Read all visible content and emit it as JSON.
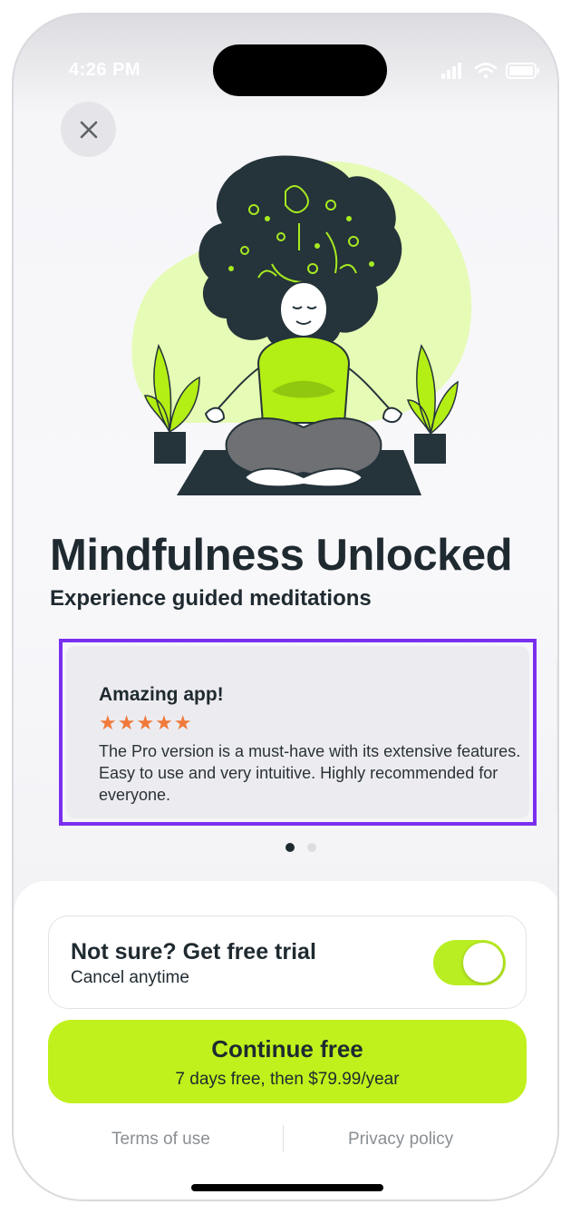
{
  "status_bar": {
    "time": "4:26 PM"
  },
  "close_icon": "close-icon",
  "header": {
    "title": "Mindfulness Unlocked",
    "subtitle": "Experience guided meditations"
  },
  "review": {
    "title": "Amazing app!",
    "rating": 5,
    "stars": "★★★★★",
    "text": "The Pro version is a must-have with its extensive features. Easy to use and very intuitive. Highly recommended for everyone."
  },
  "carousel": {
    "pages": 2,
    "active_index": 0
  },
  "trial": {
    "title": "Not sure? Get free trial",
    "subtitle": "Cancel anytime",
    "enabled": true
  },
  "cta": {
    "label": "Continue free",
    "sub": "7 days free, then $79.99/year"
  },
  "footer": {
    "terms": "Terms of use",
    "privacy": "Privacy policy"
  },
  "colors": {
    "accent": "#c0f11c",
    "dark": "#1f2a30",
    "star": "#f07a3c",
    "highlight_border": "#7a2ff0"
  }
}
